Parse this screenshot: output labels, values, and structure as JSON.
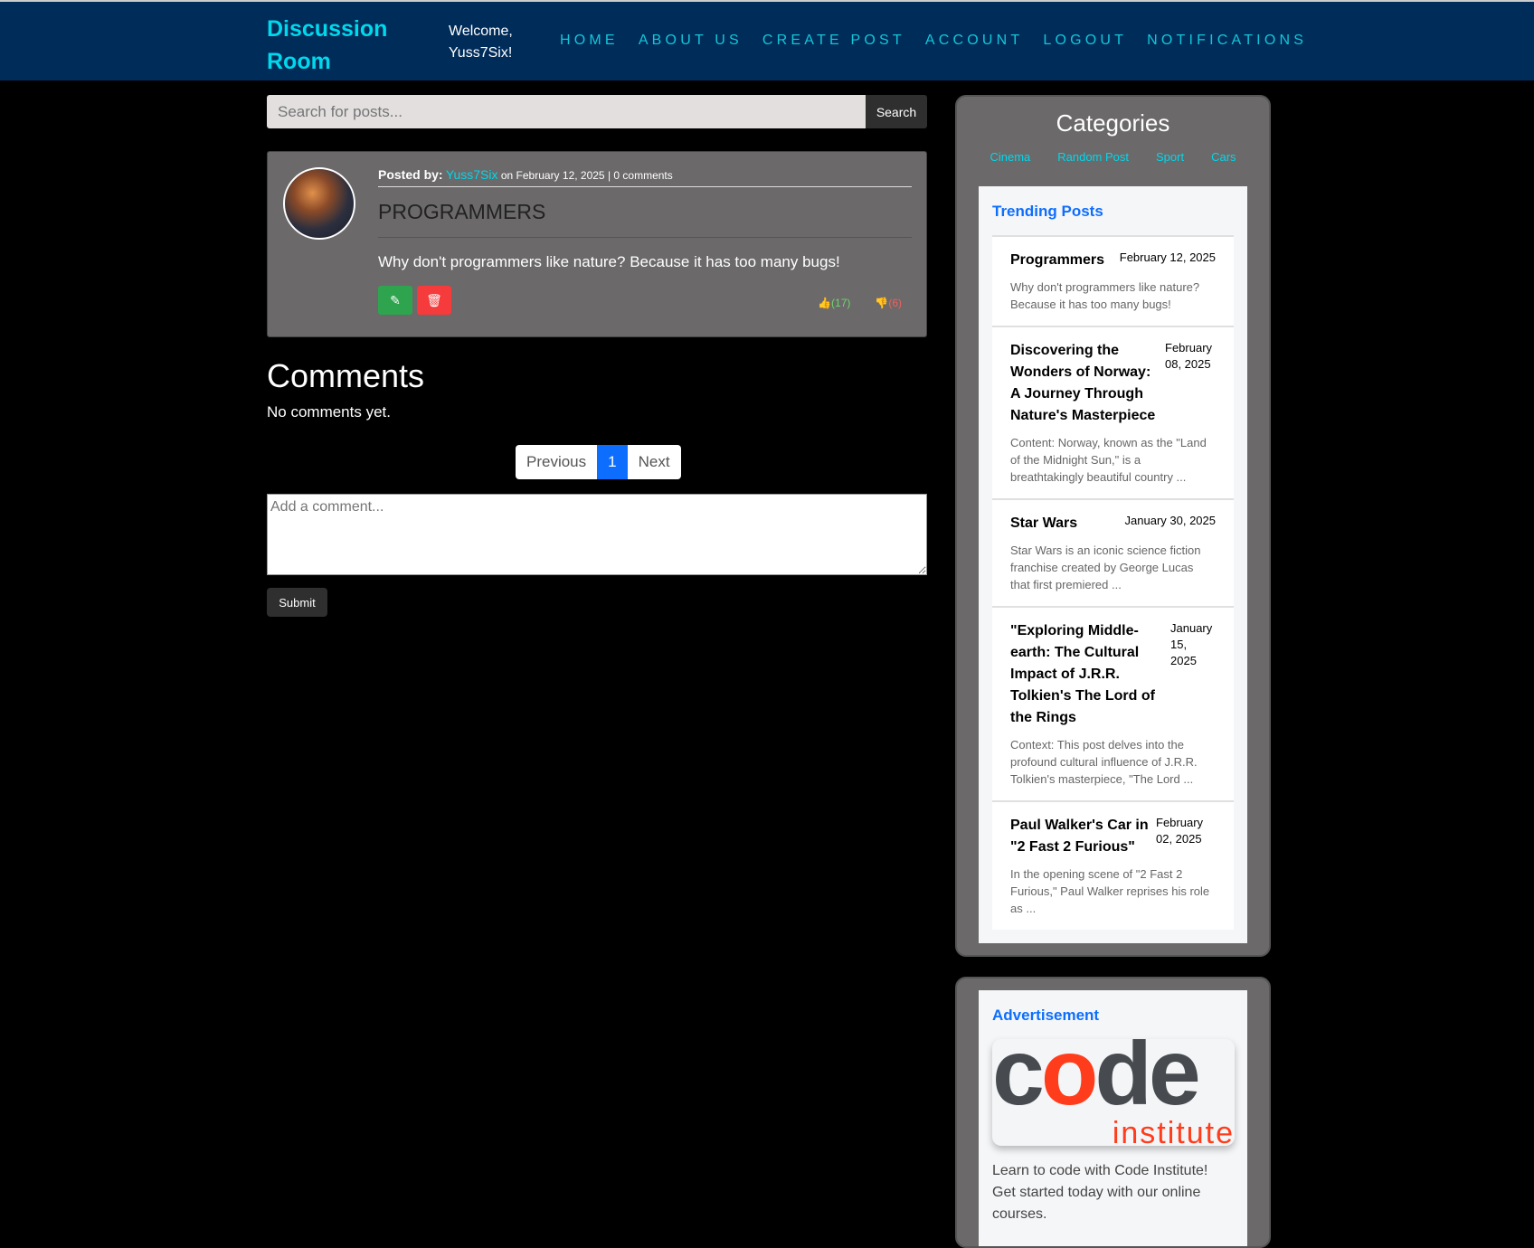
{
  "header": {
    "brand": "Discussion Room",
    "welcome": "Welcome, Yuss7Six!",
    "nav": [
      "HOME",
      "ABOUT US",
      "CREATE POST",
      "ACCOUNT",
      "LOGOUT",
      "NOTIFICATIONS"
    ]
  },
  "search": {
    "placeholder": "Search for posts...",
    "button": "Search"
  },
  "post": {
    "posted_by_label": "Posted by:",
    "author": "Yuss7Six",
    "meta": "on February 12, 2025 | 0 comments",
    "title": "PROGRAMMERS",
    "body": "Why don't programmers like nature? Because it has too many bugs!",
    "likes": "(17)",
    "dislikes": "(6)"
  },
  "comments": {
    "heading": "Comments",
    "empty": "No comments yet.",
    "placeholder": "Add a comment...",
    "submit": "Submit"
  },
  "pagination": {
    "prev": "Previous",
    "current": "1",
    "next": "Next"
  },
  "sidebar": {
    "title": "Categories",
    "categories": [
      "Cinema",
      "Random Post",
      "Sport",
      "Cars"
    ],
    "trending_title": "Trending Posts",
    "trending": [
      {
        "title": "Programmers",
        "date": "February 12, 2025",
        "excerpt": "Why don't programmers like nature? Because it has too many bugs!"
      },
      {
        "title": "Discovering the Wonders of Norway: A Journey Through Nature's Masterpiece",
        "date": "February 08, 2025",
        "excerpt": "Content: Norway, known as the \"Land of the Midnight Sun,\" is a breathtakingly beautiful country ..."
      },
      {
        "title": "Star Wars",
        "date": "January 30, 2025",
        "excerpt": "Star Wars is an iconic science fiction franchise created by George Lucas that first premiered ..."
      },
      {
        "title": "\"Exploring Middle-earth: The Cultural Impact of J.R.R. Tolkien's The Lord of the Rings",
        "date": "January 15, 2025",
        "excerpt": "Context: This post delves into the profound cultural influence of J.R.R. Tolkien's masterpiece, \"The Lord ..."
      },
      {
        "title": "Paul Walker's Car in \"2 Fast 2 Furious\"",
        "date": "February 02, 2025",
        "excerpt": "In the opening scene of \"2 Fast 2 Furious,\" Paul Walker reprises his role as ..."
      }
    ]
  },
  "ad": {
    "title": "Advertisement",
    "logo_text": "code institute",
    "text": "Learn to code with Code Institute! Get started today with our online courses."
  }
}
